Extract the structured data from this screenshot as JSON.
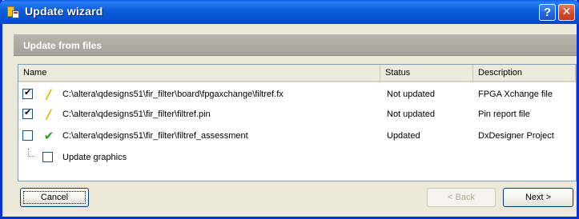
{
  "window": {
    "title": "Update wizard",
    "help_label": "?",
    "close_label": "✕"
  },
  "section": {
    "title": "Update from files"
  },
  "table": {
    "columns": [
      "Name",
      "Status",
      "Description"
    ],
    "rows": [
      {
        "checked": true,
        "icon": "warning-pencil-icon",
        "name": "C:\\altera\\qdesigns51\\fir_filter\\board\\fpgaxchange\\filtref.fx",
        "status": "Not updated",
        "description": "FPGA Xchange file"
      },
      {
        "checked": true,
        "icon": "warning-pencil-icon",
        "name": "C:\\altera\\qdesigns51\\fir_filter\\filtref.pin",
        "status": "Not updated",
        "description": "Pin report file"
      },
      {
        "checked": false,
        "icon": "green-check-icon",
        "name": "C:\\altera\\qdesigns51\\fir_filter\\filtref_assessment",
        "status": "Updated",
        "description": "DxDesigner Project"
      }
    ],
    "sub_item": {
      "checked": false,
      "label": "Update graphics"
    }
  },
  "buttons": {
    "cancel": "Cancel",
    "back": "< Back",
    "next": "Next >"
  }
}
